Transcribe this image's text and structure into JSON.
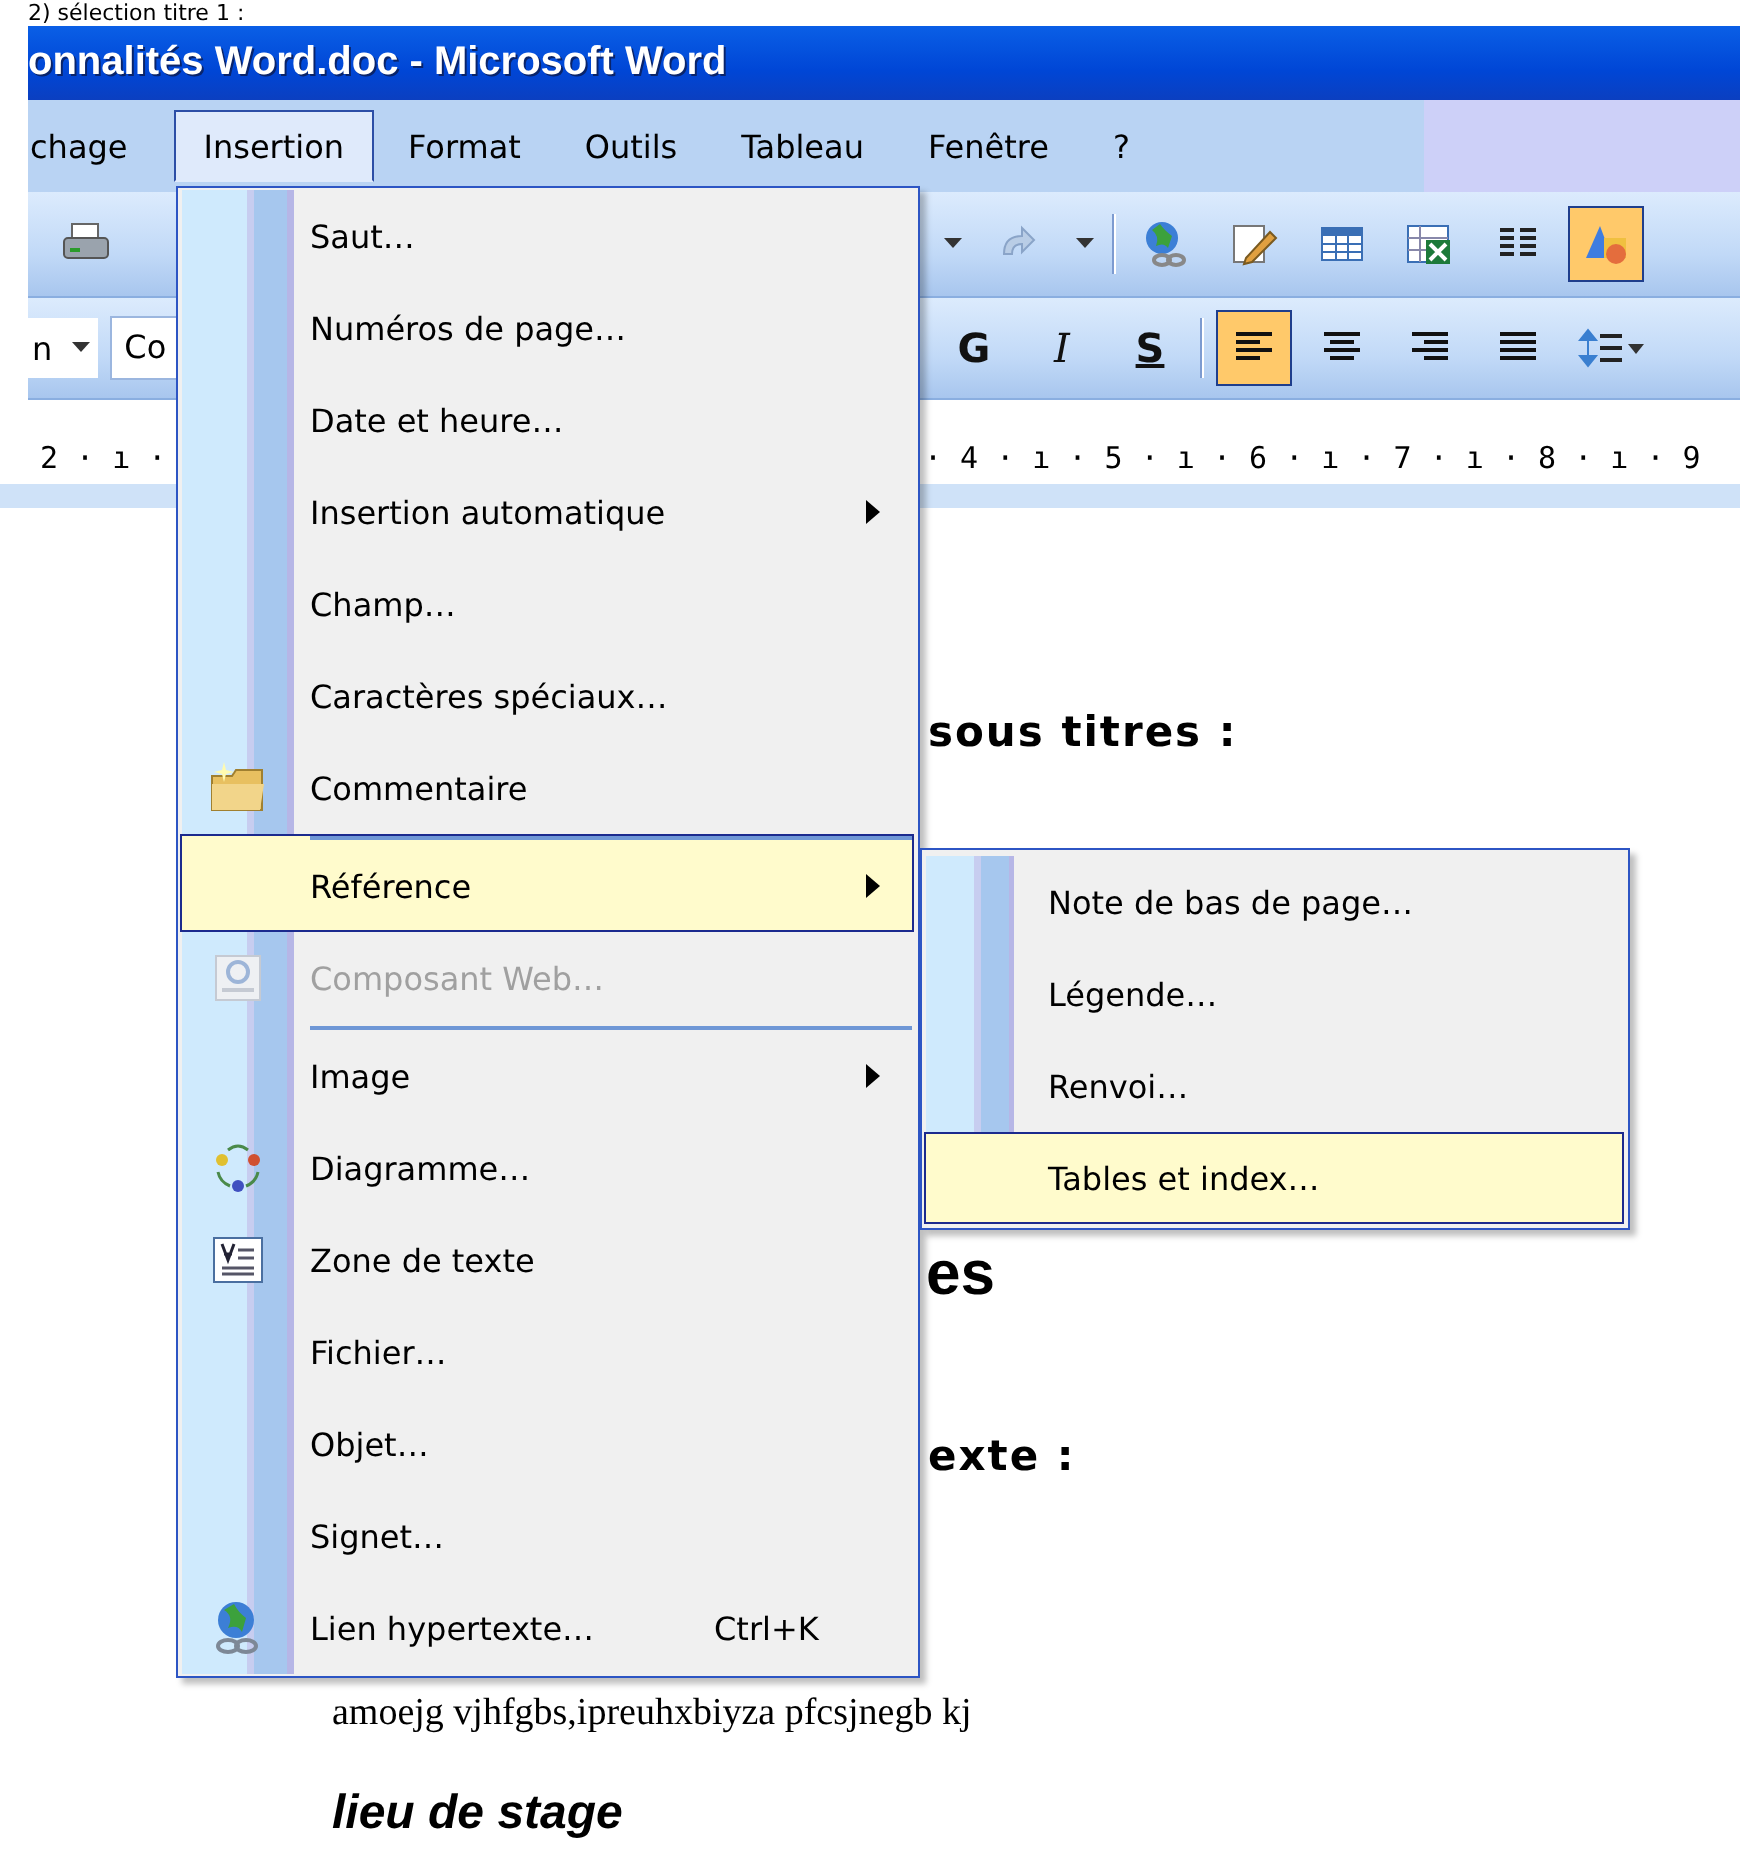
{
  "document_caption": "2) sélection titre 1 :",
  "window": {
    "title": "onnalités Word.doc - Microsoft Word"
  },
  "menu_bar": [
    {
      "label": "chage",
      "selected": false
    },
    {
      "label": "Insertion",
      "selected": true
    },
    {
      "label": "Format",
      "selected": false
    },
    {
      "label": "Outils",
      "selected": false
    },
    {
      "label": "Tableau",
      "selected": false
    },
    {
      "label": "Fenêtre",
      "selected": false
    },
    {
      "label": "?",
      "selected": false
    }
  ],
  "standard_toolbar": {
    "buttons": [
      {
        "selected": false
      },
      {
        "selected": false
      },
      {
        "selected": false
      },
      {
        "selected": false
      },
      {
        "selected": false
      },
      {
        "selected": false
      },
      {
        "selected": false
      },
      {
        "selected": false
      },
      {
        "selected": false
      },
      {
        "selected": true
      }
    ]
  },
  "formatting_toolbar": {
    "style_field": "n",
    "font_field": "Co",
    "buttons": [
      {
        "label": "G",
        "selected": false
      },
      {
        "label": "I",
        "selected": false
      },
      {
        "label": "S",
        "selected": false
      }
    ],
    "alignment": [
      {
        "selected": true
      },
      {
        "selected": false
      },
      {
        "selected": false
      },
      {
        "selected": false
      }
    ]
  },
  "ruler": {
    "left": "2 · ı ·",
    "right": "· 4 · ı · 5 · ı · 6 · ı · 7 · ı · 8 · ı · 9"
  },
  "document": {
    "fragments": [
      {
        "kind": "heading",
        "text": "sous titres :"
      },
      {
        "kind": "title",
        "text": "es"
      },
      {
        "kind": "heading",
        "text": "exte :"
      },
      {
        "kind": "body",
        "text": "amoejg vjhfgbs,ipreuhxbiyza pfcsjnegb kj"
      },
      {
        "kind": "subtitle",
        "text": "lieu de stage"
      }
    ]
  },
  "insert_menu": {
    "items": [
      {
        "label": "Saut…",
        "selected": false,
        "disabled": false,
        "submenu": false,
        "separator_before": false
      },
      {
        "label": "Numéros de page…",
        "selected": false,
        "disabled": false,
        "submenu": false,
        "separator_before": false
      },
      {
        "label": "Date et heure…",
        "selected": false,
        "disabled": false,
        "submenu": false,
        "separator_before": false
      },
      {
        "label": "Insertion automatique",
        "selected": false,
        "disabled": false,
        "submenu": true,
        "separator_before": false
      },
      {
        "label": "Champ…",
        "selected": false,
        "disabled": false,
        "submenu": false,
        "separator_before": false
      },
      {
        "label": "Caractères spéciaux…",
        "selected": false,
        "disabled": false,
        "submenu": false,
        "separator_before": false
      },
      {
        "label": "Commentaire",
        "selected": false,
        "disabled": false,
        "submenu": false,
        "separator_before": false
      },
      {
        "label": "Référence",
        "selected": true,
        "disabled": false,
        "submenu": true,
        "separator_before": true
      },
      {
        "label": "Composant Web…",
        "selected": false,
        "disabled": true,
        "submenu": false,
        "separator_before": false
      },
      {
        "label": "Image",
        "selected": false,
        "disabled": false,
        "submenu": true,
        "separator_before": true
      },
      {
        "label": "Diagramme…",
        "selected": false,
        "disabled": false,
        "submenu": false,
        "separator_before": false
      },
      {
        "label": "Zone de texte",
        "selected": false,
        "disabled": false,
        "submenu": false,
        "separator_before": false
      },
      {
        "label": "Fichier…",
        "selected": false,
        "disabled": false,
        "submenu": false,
        "separator_before": false
      },
      {
        "label": "Objet…",
        "selected": false,
        "disabled": false,
        "submenu": false,
        "separator_before": false
      },
      {
        "label": "Signet…",
        "selected": false,
        "disabled": false,
        "submenu": false,
        "separator_before": false
      },
      {
        "label": "Lien hypertexte…",
        "shortcut": "Ctrl+K",
        "selected": false,
        "disabled": false,
        "submenu": false,
        "separator_before": false
      }
    ]
  },
  "reference_submenu": {
    "items": [
      {
        "label": "Note de bas de page…",
        "selected": false
      },
      {
        "label": "Légende…",
        "selected": false
      },
      {
        "label": "Renvoi…",
        "selected": false
      },
      {
        "label": "Tables et index…",
        "selected": true
      }
    ]
  }
}
